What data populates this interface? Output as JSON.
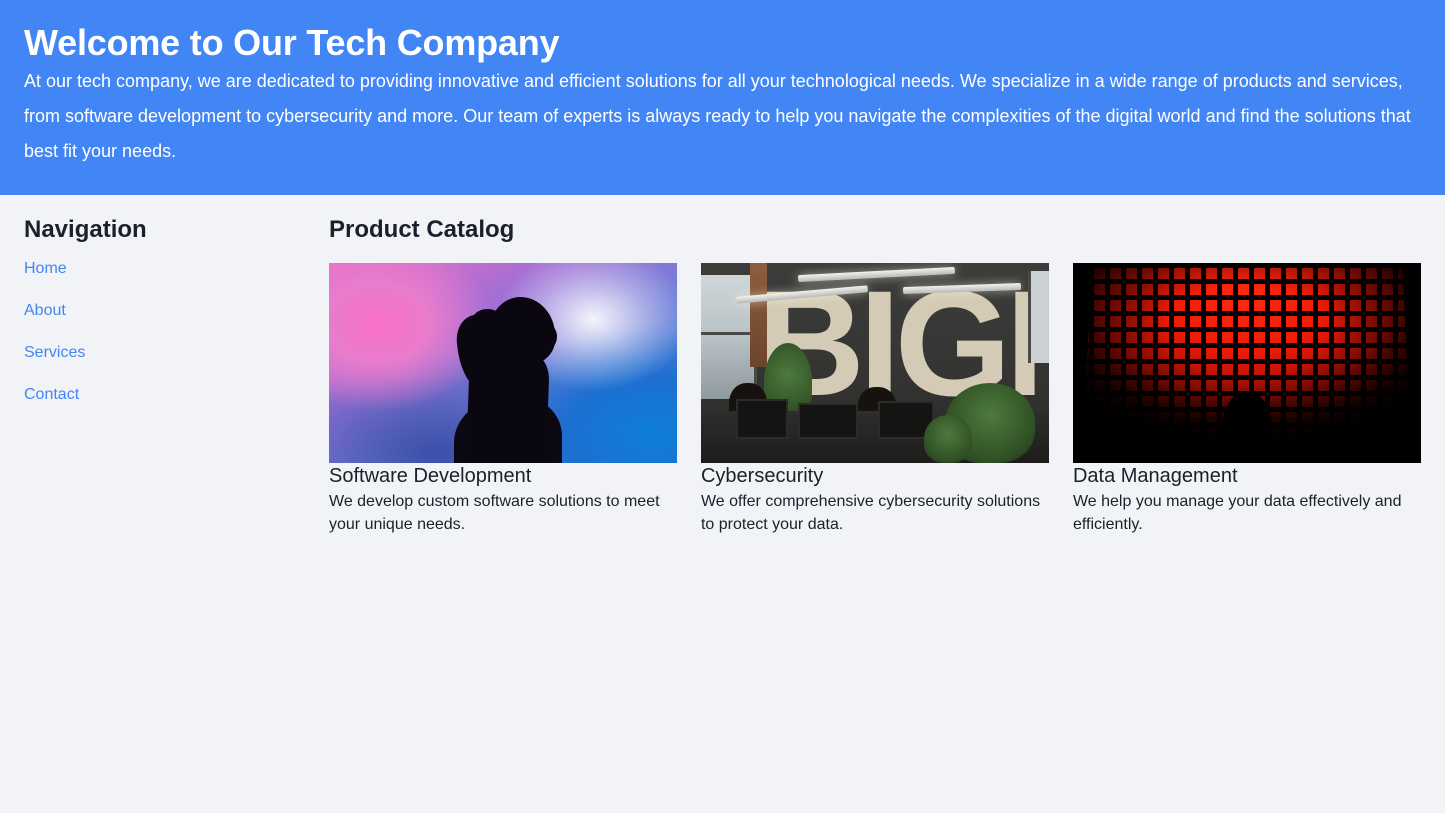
{
  "header": {
    "title": "Welcome to Our Tech Company",
    "intro": "At our tech company, we are dedicated to providing innovative and efficient solutions for all your technological needs. We specialize in a wide range of products and services, from software development to cybersecurity and more. Our team of experts is always ready to help you navigate the complexities of the digital world and find the solutions that best fit your needs.",
    "background_color": "#4285f4",
    "text_color": "#ffffff"
  },
  "sidebar": {
    "title": "Navigation",
    "link_color": "#4285f4",
    "items": [
      {
        "label": "Home"
      },
      {
        "label": "About"
      },
      {
        "label": "Services"
      },
      {
        "label": "Contact"
      }
    ]
  },
  "catalog": {
    "title": "Product Catalog",
    "cards": [
      {
        "image_alt": "silhouette-of-person-against-colorful-gradient",
        "title": "Software Development",
        "description": "We develop custom software solutions to meet your unique needs."
      },
      {
        "image_alt": "modern-office-interior-with-large-wall-signage",
        "title": "Cybersecurity",
        "description": "We offer comprehensive cybersecurity solutions to protect your data."
      },
      {
        "image_alt": "silhouette-in-front-of-red-led-grid-wall",
        "title": "Data Management",
        "description": "We help you manage your data effectively and efficiently."
      }
    ]
  },
  "page": {
    "background_color": "#f2f3f7",
    "office_wall_text": "BIGME"
  }
}
